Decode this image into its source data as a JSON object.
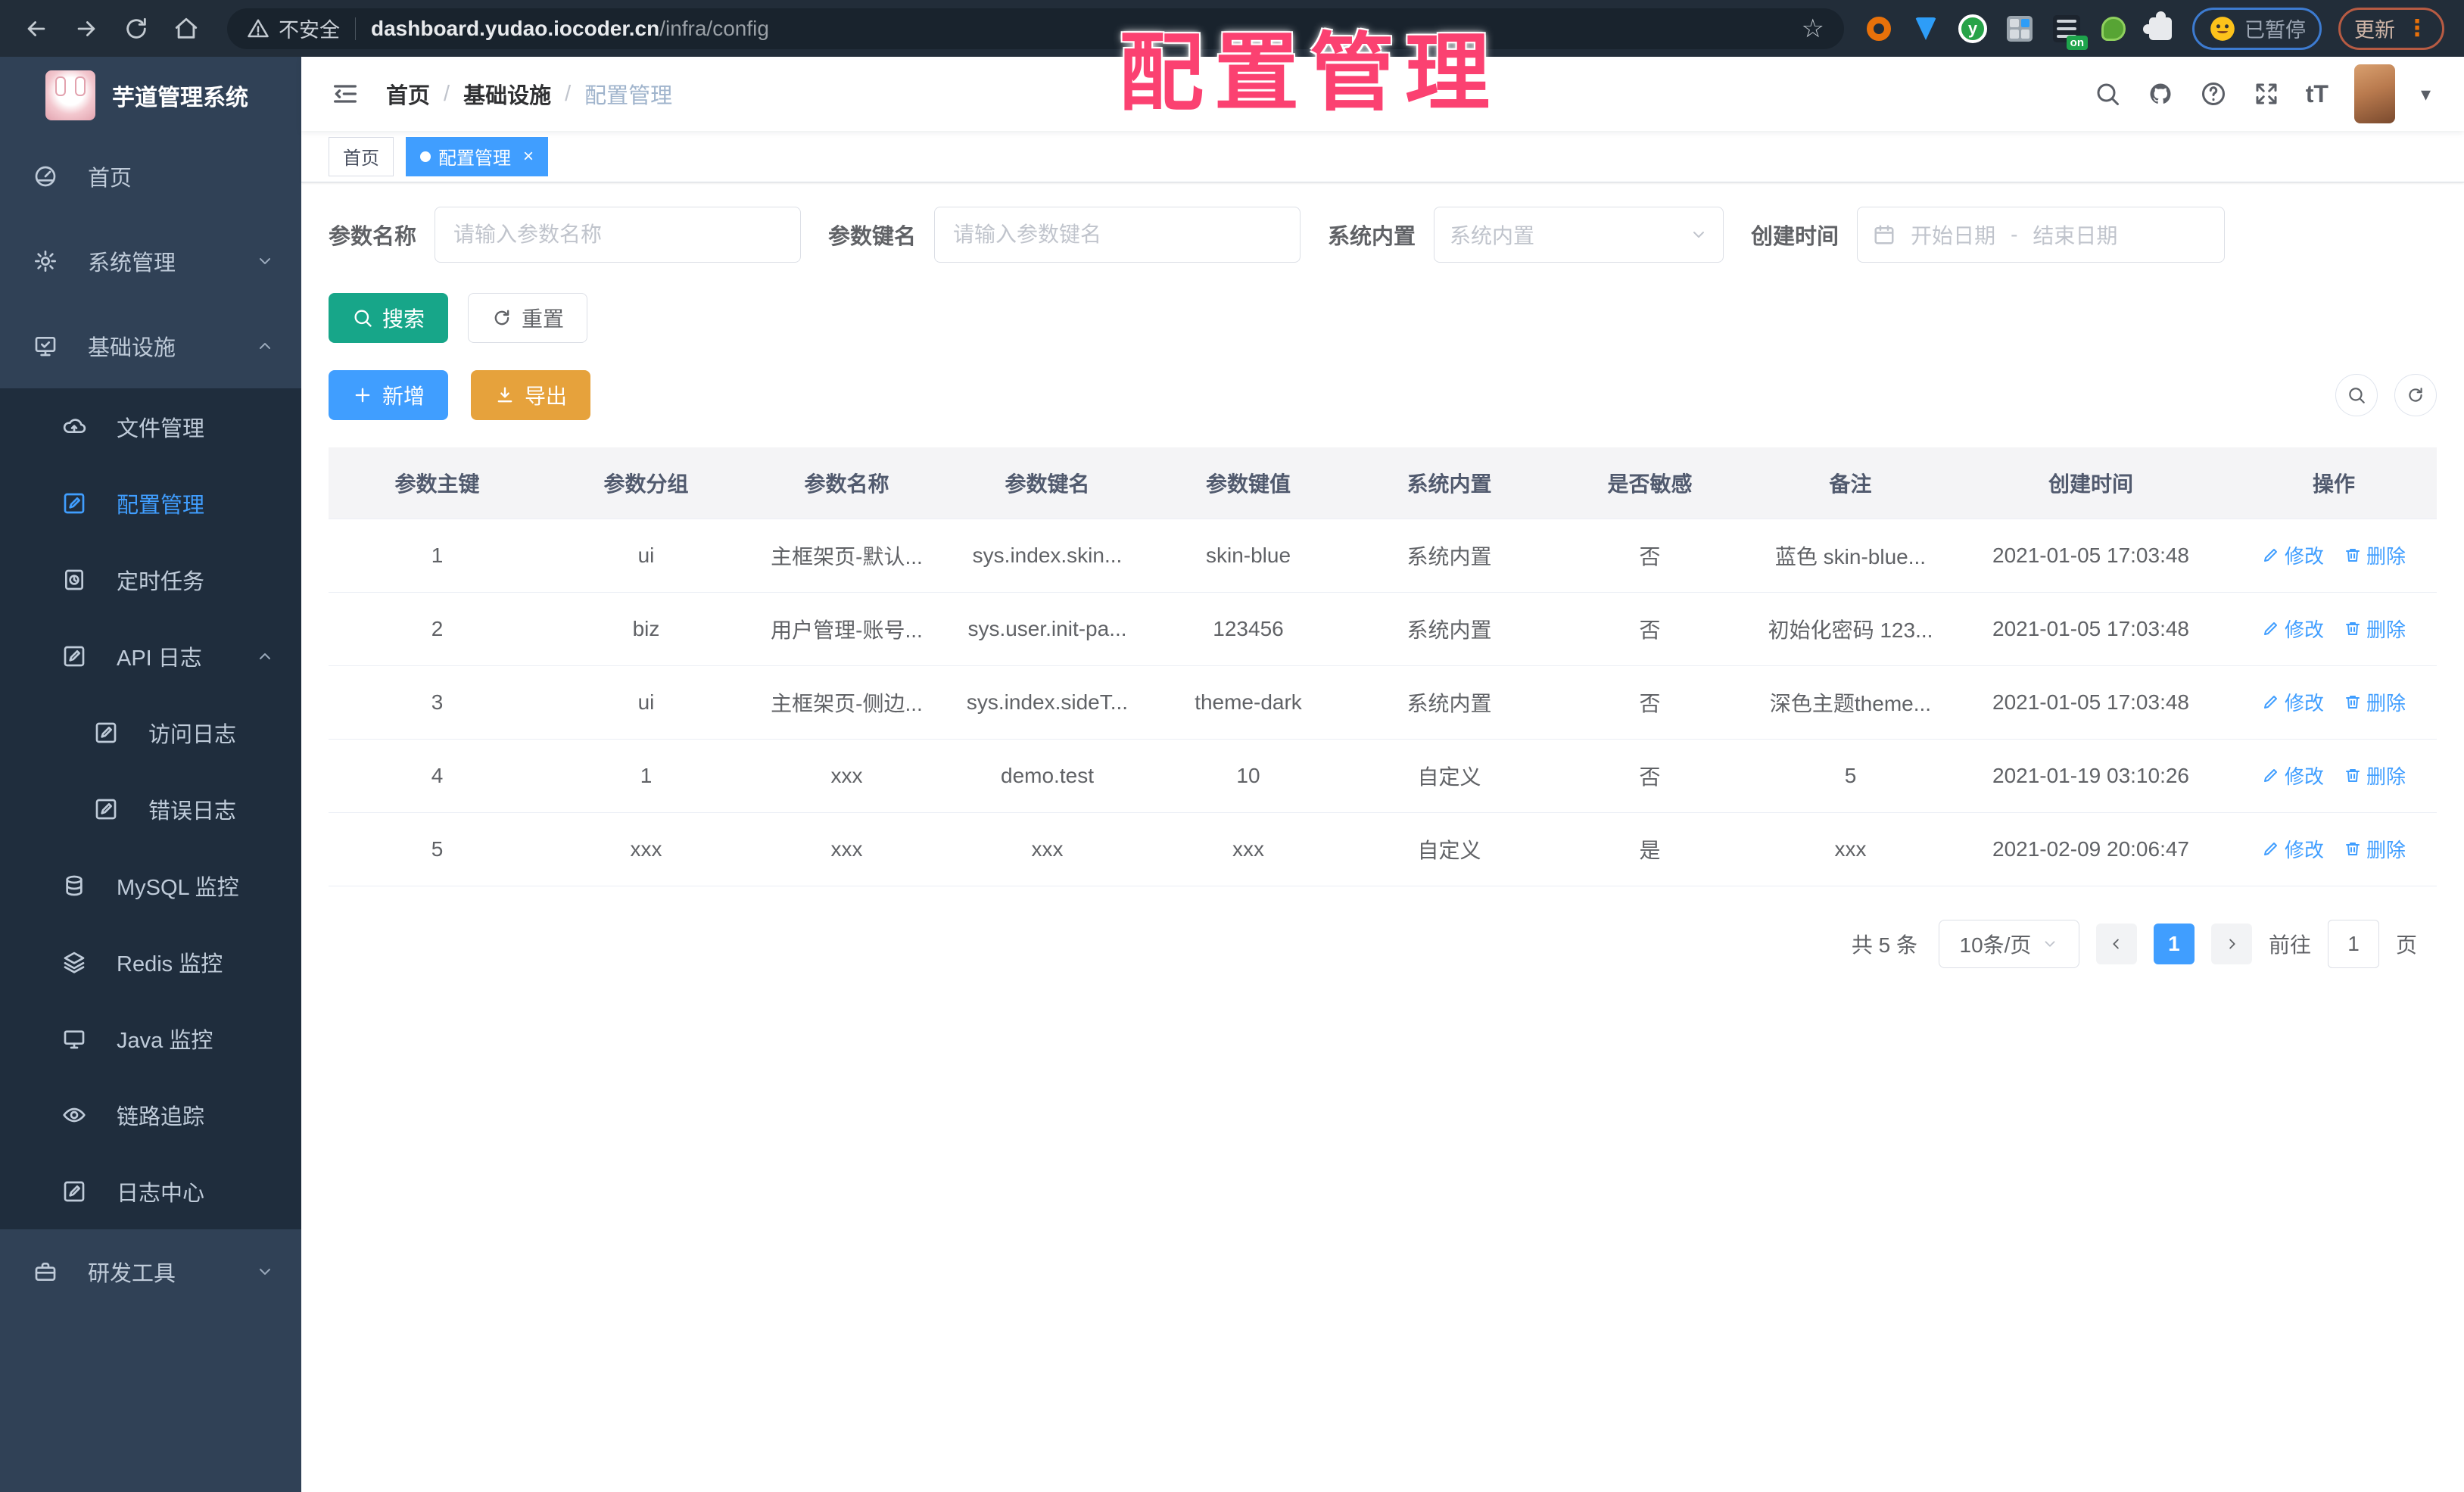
{
  "overlay": {
    "title": "配置管理"
  },
  "browser": {
    "security_label": "不安全",
    "url_host": "dashboard.yudao.iocoder.cn",
    "url_path": "/infra/config",
    "extension_badge": "on",
    "paused_badge": "已暂停",
    "update_button": "更新"
  },
  "sidebar": {
    "logo_title": "芋道管理系统",
    "home": "首页",
    "system": "系统管理",
    "infra": "基础设施",
    "file": "文件管理",
    "config": "配置管理",
    "job": "定时任务",
    "api_log": "API 日志",
    "access_log": "访问日志",
    "error_log": "错误日志",
    "mysql": "MySQL 监控",
    "redis": "Redis 监控",
    "java": "Java 监控",
    "trace": "链路追踪",
    "log_center": "日志中心",
    "dev_tools": "研发工具"
  },
  "header": {
    "breadcrumb": [
      "首页",
      "基础设施",
      "配置管理"
    ],
    "separator": "/",
    "font_icon_text": "tT"
  },
  "tags": {
    "home": "首页",
    "active": "配置管理"
  },
  "filters": {
    "name_label": "参数名称",
    "name_placeholder": "请输入参数名称",
    "key_label": "参数键名",
    "key_placeholder": "请输入参数键名",
    "type_label": "系统内置",
    "type_placeholder": "系统内置",
    "date_label": "创建时间",
    "date_start": "开始日期",
    "date_sep": "-",
    "date_end": "结束日期",
    "search": "搜索",
    "reset": "重置"
  },
  "toolbar": {
    "add": "新增",
    "export": "导出"
  },
  "table": {
    "columns": [
      "参数主键",
      "参数分组",
      "参数名称",
      "参数键名",
      "参数键值",
      "系统内置",
      "是否敏感",
      "备注",
      "创建时间",
      "操作"
    ],
    "rows": [
      [
        "1",
        "ui",
        "主框架页-默认...",
        "sys.index.skin...",
        "skin-blue",
        "系统内置",
        "否",
        "蓝色 skin-blue...",
        "2021-01-05 17:03:48"
      ],
      [
        "2",
        "biz",
        "用户管理-账号...",
        "sys.user.init-pa...",
        "123456",
        "系统内置",
        "否",
        "初始化密码 123...",
        "2021-01-05 17:03:48"
      ],
      [
        "3",
        "ui",
        "主框架页-侧边...",
        "sys.index.sideT...",
        "theme-dark",
        "系统内置",
        "否",
        "深色主题theme...",
        "2021-01-05 17:03:48"
      ],
      [
        "4",
        "1",
        "xxx",
        "demo.test",
        "10",
        "自定义",
        "否",
        "5",
        "2021-01-19 03:10:26"
      ],
      [
        "5",
        "xxx",
        "xxx",
        "xxx",
        "xxx",
        "自定义",
        "是",
        "xxx",
        "2021-02-09 20:06:47"
      ]
    ],
    "edit": "修改",
    "delete": "删除"
  },
  "pagination": {
    "total": "共 5 条",
    "page_size": "10条/页",
    "page": "1",
    "goto": "前往",
    "goto_value": "1",
    "unit": "页"
  },
  "colors": {
    "accent": "#409EFF",
    "search_teal": "#17A689",
    "export_orange": "#E6A23C",
    "overlay_pink": "#FB4171",
    "sidebar_bg": "#304156",
    "submenu_bg": "#1F2D3D"
  }
}
